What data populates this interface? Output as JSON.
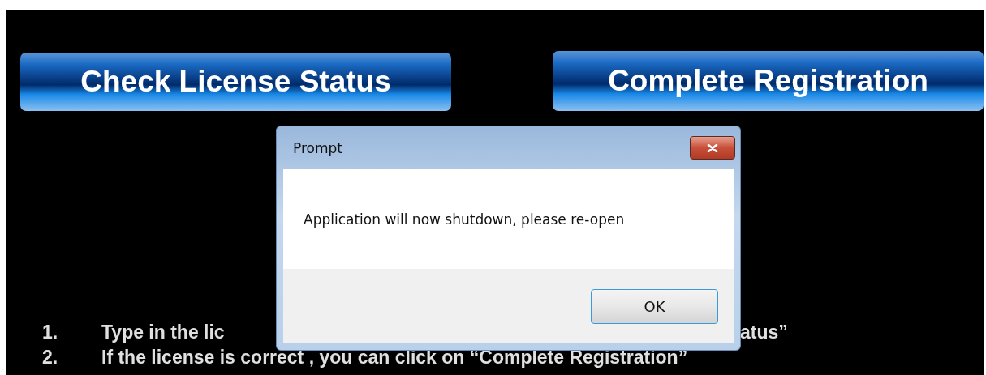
{
  "buttons": [
    {
      "label": "Check License Status"
    },
    {
      "label": "Complete Registration"
    }
  ],
  "instructions": [
    {
      "number": "1.",
      "text_parts": [
        "Type in the lic",
        "atus”"
      ]
    },
    {
      "number": "2.",
      "text_parts": [
        "If the license is correct , you can click on “Complete  Registration”"
      ]
    }
  ],
  "dialog": {
    "title": "Prompt",
    "message": "Application will now shutdown, please re-open",
    "buttons": [
      "OK"
    ]
  }
}
